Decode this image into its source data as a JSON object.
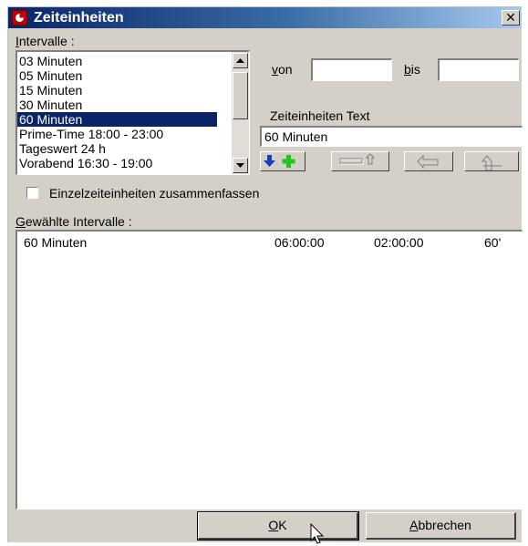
{
  "window": {
    "title": "Zeiteinheiten",
    "close_glyph": "✕"
  },
  "intervals": {
    "label_prefix": "I",
    "label_rest": "ntervalle :",
    "items": [
      "03 Minuten",
      "05 Minuten",
      "15 Minuten",
      "30 Minuten",
      "60 Minuten",
      "Prime-Time 18:00 - 23:00",
      "Tageswert 24 h",
      "Vorabend 16:30 - 19:00"
    ],
    "selected_index": 4
  },
  "range": {
    "von_prefix": "v",
    "von_rest": "on",
    "bis_prefix": "b",
    "bis_rest": "is",
    "von_value": "",
    "bis_value": ""
  },
  "text_field": {
    "label": "Zeiteinheiten Text",
    "value": "60 Minuten"
  },
  "toolbar": {
    "buttons": [
      {
        "icon": "add-down-arrow-icon",
        "enabled": true
      },
      {
        "icon": "move-up-icon",
        "enabled": false
      },
      {
        "icon": "undo-left-icon",
        "enabled": false
      },
      {
        "icon": "replace-up-icon",
        "enabled": false
      }
    ]
  },
  "combine": {
    "label": "Einzelzeiteinheiten zusammenfassen",
    "checked": false
  },
  "selected_intervals": {
    "label_prefix": "G",
    "label_rest": "ewählte Intervalle :",
    "rows": [
      {
        "name": "60 Minuten",
        "start": "06:00:00",
        "duration": "02:00:00",
        "unit": "60'"
      }
    ]
  },
  "buttons": {
    "ok_prefix": "O",
    "ok_rest": "K",
    "cancel_prefix": "A",
    "cancel_rest": "bbrechen"
  },
  "colors": {
    "titlebar_start": "#0a246a",
    "titlebar_end": "#a6caf0",
    "selection": "#0a246a",
    "dialog_face": "#d4d0c8",
    "add_arrow": "#1040c0",
    "add_plus": "#22c322"
  }
}
